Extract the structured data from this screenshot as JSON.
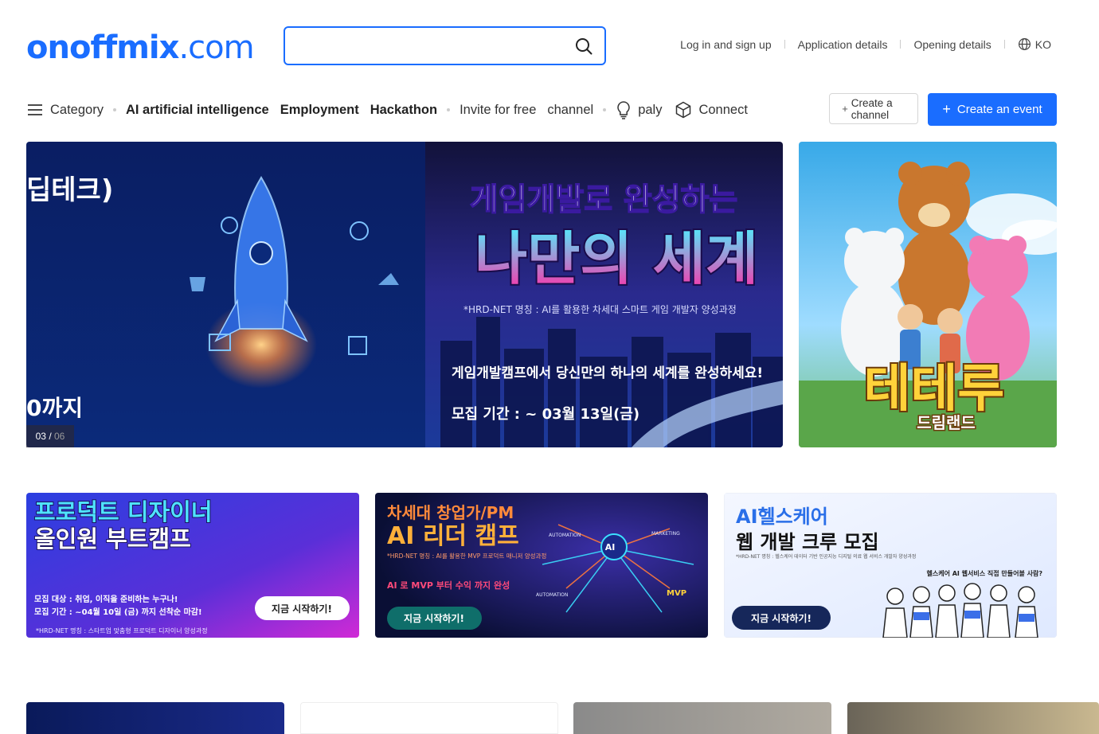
{
  "header": {
    "logo_main": "onoffmix",
    "logo_tld": ".com",
    "search": {
      "placeholder": ""
    },
    "links": [
      {
        "label": "Log in and sign up"
      },
      {
        "label": "Application details"
      },
      {
        "label": "Opening details"
      }
    ],
    "language": "KO"
  },
  "categories": {
    "menu_label": "Category",
    "items": [
      {
        "label": "AI artificial intelligence"
      },
      {
        "label": "Employment"
      },
      {
        "label": "Hackathon"
      }
    ],
    "invite_label": "Invite for free",
    "channel_label": "channel",
    "paly_label": "paly",
    "connect_label": "Connect"
  },
  "actions": {
    "create_channel": "Create a channel",
    "create_event": "Create an event"
  },
  "hero": {
    "left_fragment_top": "딥테크)",
    "left_fragment_bottom": "0까지",
    "title_small": "게임개발로 완성하는",
    "title_big": "나만의 세계",
    "caption": "*HRD-NET 명칭 : AI를 활용한 차세대 스마트 게임 개발자 양성과정",
    "sub": "게임개발캠프에서 당신만의 하나의 세계를 완성하세요!",
    "period": "모집 기간 : ~ 03월 13일(금)",
    "pager_current": "03",
    "pager_total": "06"
  },
  "side_banner": {
    "title": "테테루",
    "subtitle": "드림랜드"
  },
  "cards": [
    {
      "line1": "프로덕트 디자이너",
      "line2": "올인원 부트캠프",
      "target": "모집 대상 : 취업, 이직을 준비하는 누구나!",
      "period": "모집 기간 : ~04월 10일 (금) 까지 선착순 마감!",
      "note": "*HRD-NET 명칭 : 스타트업 맞춤형 프로덕트 디자이너 양성과정",
      "cta": "지금 시작하기!"
    },
    {
      "line1": "차세대 창업가/PM",
      "line2": "AI 리더 캠프",
      "note": "*HRD-NET 명칭 : AI를 활용한 MVP 프로덕트 매니저 양성과정",
      "highlight": "AI 로 MVP 부터 수익 까지 완성",
      "labels": [
        "AUTOMATION",
        "MARKETING",
        "AI",
        "AUTOMATION",
        "MVP"
      ],
      "cta": "지금 시작하기!"
    },
    {
      "line1": "AI헬스케어",
      "line2": "웹 개발 크루 모집",
      "note": "*HRD-NET 명칭 : 헬스케어 데이터 기반 인공지능 디지털 의료 웹 서비스 개발자 양성과정",
      "tagline": "헬스케어 AI 웹서비스 직접 만들어볼 사람?",
      "cta": "지금 시작하기!"
    }
  ],
  "colors": {
    "brand": "#1a6dff",
    "card1_bg": "#4a2bd8",
    "card2_bg": "#0d1440",
    "card3_bg": "#eef4ff"
  }
}
